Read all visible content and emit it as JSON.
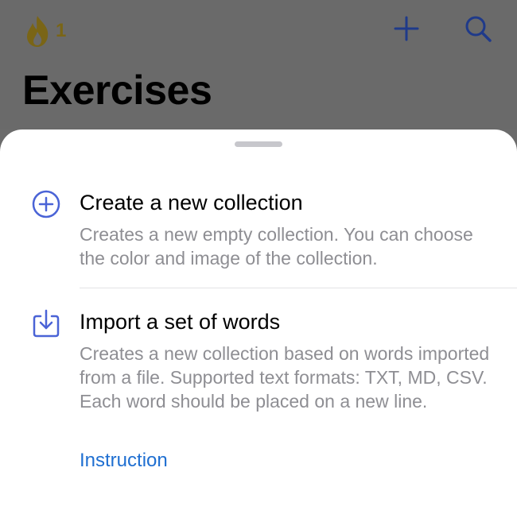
{
  "header": {
    "streak_count": "1",
    "title": "Exercises",
    "icons": {
      "streak": "flame-icon",
      "add": "plus-icon",
      "search": "search-icon"
    }
  },
  "sheet": {
    "options": [
      {
        "title": "Create a new collection",
        "description": "Creates a new empty collection. You can choose the color and image of the collection.",
        "icon": "plus-circle-icon"
      },
      {
        "title": "Import a set of words",
        "description": "Creates a new collection based on words imported from a file. Supported text formats: TXT, MD, CSV. Each word should be placed on a new line.",
        "icon": "import-icon",
        "link": "Instruction"
      }
    ]
  },
  "colors": {
    "accent": "#4a63d6",
    "link": "#1f6fd1",
    "streak": "#7a6516"
  }
}
